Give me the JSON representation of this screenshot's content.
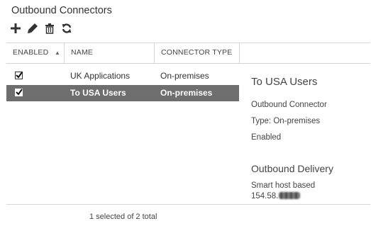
{
  "page": {
    "title": "Outbound Connectors"
  },
  "toolbar": [
    {
      "name": "add-button",
      "icon": "plus-icon"
    },
    {
      "name": "edit-button",
      "icon": "pencil-icon"
    },
    {
      "name": "delete-button",
      "icon": "trash-icon"
    },
    {
      "name": "refresh-button",
      "icon": "refresh-icon"
    }
  ],
  "table": {
    "columns": [
      "ENABLED",
      "NAME",
      "CONNECTOR TYPE"
    ],
    "rows": [
      {
        "enabled": true,
        "name": "UK Applications",
        "type": "On-premises",
        "selected": false
      },
      {
        "enabled": true,
        "name": "To USA Users",
        "type": "On-premises",
        "selected": true
      }
    ]
  },
  "details": {
    "title": "To USA Users",
    "connector_kind": "Outbound Connector",
    "type_line": "Type: On-premises",
    "status": "Enabled",
    "delivery_heading": "Outbound Delivery",
    "delivery_mode": "Smart host based",
    "smart_host_prefix": "154.58."
  },
  "status": {
    "text": "1 selected of 2 total"
  },
  "colors": {
    "selected_row": "#6e6e6e",
    "icon": "#333333",
    "divider": "#d6d6d6"
  }
}
